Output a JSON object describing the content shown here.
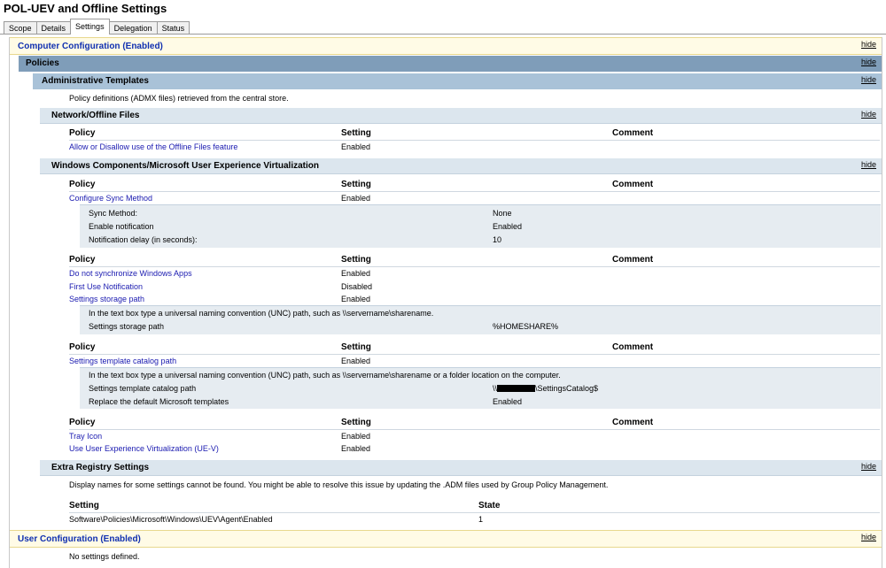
{
  "window": {
    "title": "POL-UEV and Offline Settings"
  },
  "tabs": [
    "Scope",
    "Details",
    "Settings",
    "Delegation",
    "Status"
  ],
  "active_tab": "Settings",
  "hide_label": "hide",
  "computer_config": {
    "title": "Computer Configuration (Enabled)",
    "policies_title": "Policies",
    "admin_templates": {
      "title": "Administrative Templates",
      "note": "Policy definitions (ADMX files) retrieved from the central store."
    },
    "network_offline": {
      "title": "Network/Offline Files",
      "headers": {
        "policy": "Policy",
        "setting": "Setting",
        "comment": "Comment"
      },
      "rows": [
        {
          "policy": "Allow or Disallow use of the Offline Files feature",
          "setting": "Enabled"
        }
      ]
    },
    "uev": {
      "title": "Windows Components/Microsoft User Experience Virtualization",
      "headers": {
        "policy": "Policy",
        "setting": "Setting",
        "comment": "Comment"
      },
      "group1": {
        "policy": "Configure Sync Method",
        "setting": "Enabled",
        "details": [
          {
            "label": "Sync Method:",
            "value": "None"
          },
          {
            "label": "Enable notification",
            "value": "Enabled"
          },
          {
            "label": "Notification delay (in seconds):",
            "value": "10"
          }
        ]
      },
      "group2": {
        "rows": [
          {
            "policy": "Do not synchronize Windows Apps",
            "setting": "Enabled"
          },
          {
            "policy": "First Use Notification",
            "setting": "Disabled"
          },
          {
            "policy": "Settings storage path",
            "setting": "Enabled"
          }
        ],
        "detail_note": "In the text box type a universal naming convention (UNC) path, such as \\\\servername\\sharename.",
        "details": [
          {
            "label": "Settings storage path",
            "value": "%HOMESHARE%"
          }
        ]
      },
      "group3": {
        "policy": "Settings template catalog path",
        "setting": "Enabled",
        "detail_note": "In the text box type a universal naming convention (UNC) path, such as \\\\servername\\sharename or a folder location on the computer.",
        "details": [
          {
            "label": "Settings template catalog path",
            "value_prefix": "\\\\",
            "value_suffix": "\\SettingsCatalog$"
          },
          {
            "label": "Replace the default Microsoft templates",
            "value": "Enabled"
          }
        ]
      },
      "group4": {
        "rows": [
          {
            "policy": "Tray Icon",
            "setting": "Enabled"
          },
          {
            "policy": "Use User Experience Virtualization (UE-V)",
            "setting": "Enabled"
          }
        ]
      }
    },
    "extra_registry": {
      "title": "Extra Registry Settings",
      "note": "Display names for some settings cannot be found. You might be able to resolve this issue by updating the .ADM files used by Group Policy Management.",
      "headers": {
        "setting": "Setting",
        "state": "State"
      },
      "rows": [
        {
          "setting": "Software\\Policies\\Microsoft\\Windows\\UEV\\Agent\\Enabled",
          "state": "1"
        }
      ]
    }
  },
  "user_config": {
    "title": "User Configuration (Enabled)",
    "note": "No settings defined."
  }
}
